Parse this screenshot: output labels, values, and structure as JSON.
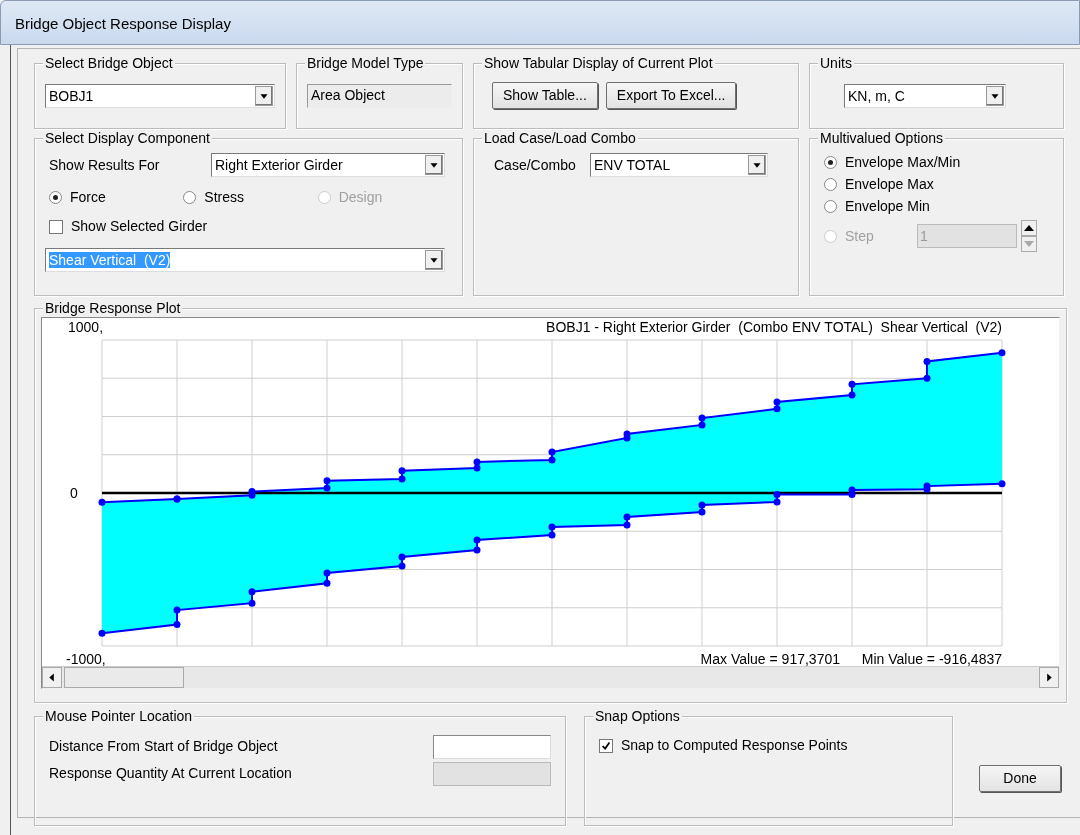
{
  "window": {
    "title": "Bridge Object Response Display"
  },
  "select_bridge_object": {
    "title": "Select Bridge Object",
    "value": "BOBJ1"
  },
  "bridge_model_type": {
    "title": "Bridge Model Type",
    "value": "Area Object"
  },
  "tabular_display": {
    "title": "Show Tabular Display of Current Plot",
    "buttons": [
      "Show Table...",
      "Export To Excel..."
    ]
  },
  "units": {
    "title": "Units",
    "value": "KN, m, C"
  },
  "display_component": {
    "title": "Select Display Component",
    "show_results_label": "Show Results For",
    "show_results_value": "Right Exterior Girder",
    "result_types": [
      {
        "label": "Force",
        "selected": true,
        "disabled": false
      },
      {
        "label": "Stress",
        "selected": false,
        "disabled": false
      },
      {
        "label": "Design",
        "selected": false,
        "disabled": true
      }
    ],
    "show_selected_girder": {
      "label": "Show Selected Girder",
      "checked": false
    },
    "component": {
      "value": "Shear Vertical  (V2)",
      "text_selected": true
    }
  },
  "load_case": {
    "title": "Load Case/Load Combo",
    "label": "Case/Combo",
    "value": "ENV TOTAL"
  },
  "multivalued": {
    "title": "Multivalued Options",
    "options": [
      {
        "label": "Envelope Max/Min",
        "selected": true,
        "disabled": false
      },
      {
        "label": "Envelope Max",
        "selected": false,
        "disabled": false
      },
      {
        "label": "Envelope Min",
        "selected": false,
        "disabled": false
      },
      {
        "label": "Step",
        "selected": false,
        "disabled": true
      }
    ],
    "step_value": "1"
  },
  "plot": {
    "title": "Bridge Response Plot",
    "plot_title": "BOBJ1 - Right Exterior Girder  (Combo ENV TOTAL)  Shear Vertical  (V2)",
    "axis_labels": [
      "1000,",
      "0",
      "-1000,"
    ],
    "max_value": "Max Value = 917,3701",
    "min_value": "Min Value = -916,4837"
  },
  "mouse_pointer": {
    "title": "Mouse Pointer Location",
    "fields": [
      {
        "label": "Distance From Start of Bridge Object",
        "disabled": false
      },
      {
        "label": "Response Quantity At Current Location",
        "disabled": true
      }
    ]
  },
  "snap_options": {
    "title": "Snap Options",
    "snap": {
      "label": "Snap to Computed Response Points",
      "checked": true
    }
  },
  "buttons": [
    "Done"
  ]
}
